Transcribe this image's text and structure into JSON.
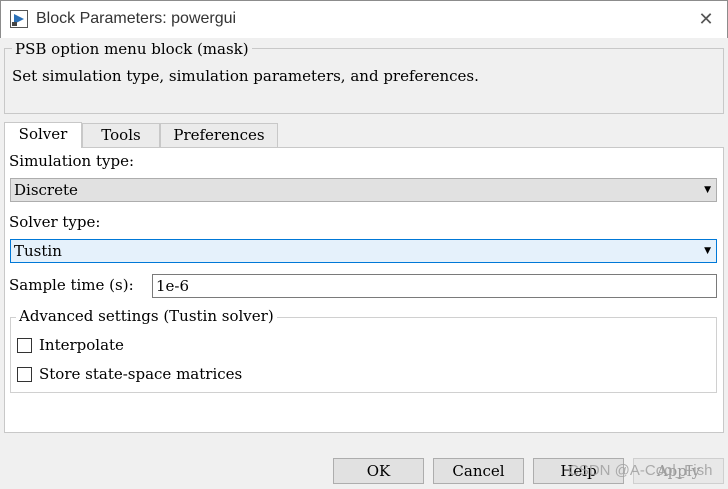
{
  "window": {
    "title": "Block Parameters: powergui",
    "close_glyph": "✕"
  },
  "mask": {
    "group_title": "PSB option menu block (mask)",
    "description": "Set simulation type, simulation parameters, and preferences."
  },
  "tabs": [
    {
      "label": "Solver",
      "active": true
    },
    {
      "label": "Tools",
      "active": false
    },
    {
      "label": "Preferences",
      "active": false
    }
  ],
  "solver": {
    "simulation_type_label": "Simulation type:",
    "simulation_type_value": "Discrete",
    "solver_type_label": "Solver type:",
    "solver_type_value": "Tustin",
    "sample_time_label": "Sample time (s):",
    "sample_time_value": "1e-6",
    "advanced_title": "Advanced settings (Tustin solver)",
    "interpolate_label": "Interpolate",
    "interpolate_checked": false,
    "store_label": "Store state-space matrices",
    "store_checked": false,
    "dropdown_caret": "▼"
  },
  "buttons": {
    "ok": "OK",
    "cancel": "Cancel",
    "help": "Help",
    "apply": "Apply"
  },
  "watermark": "CSDN @A-Cool_Fish",
  "colors": {
    "focus_border": "#0078d7",
    "focus_fill": "#e5f1fb",
    "icon_blue": "#2a6fb6"
  },
  "icons": {
    "app": "simulink-block-icon",
    "close": "close-icon",
    "caret": "chevron-down-icon"
  }
}
